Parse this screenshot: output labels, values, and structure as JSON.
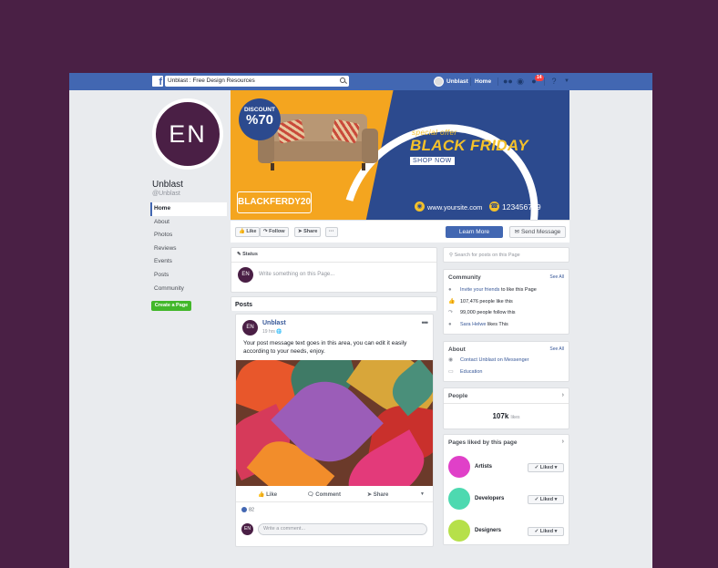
{
  "topbar": {
    "search_value": "Unblast : Free Design Resources",
    "user_name": "Unblast",
    "home_label": "Home",
    "notification_count": "14"
  },
  "profile": {
    "initials": "EN",
    "name": "Unblast",
    "handle": "@Unblast"
  },
  "nav": {
    "items": [
      "Home",
      "About",
      "Photos",
      "Reviews",
      "Events",
      "Posts",
      "Community"
    ],
    "create_page": "Create a Page"
  },
  "cover": {
    "discount_label": "DISCOUNT",
    "discount_value": "%70",
    "promo_code": "BLACKFERDY20",
    "special_offer": "special offer",
    "headline": "BLACK FRIDAY",
    "shop_now": "SHOP NOW",
    "website": "www.yoursite.com",
    "phone": "123456789",
    "colors": {
      "orange": "#f4a51f",
      "blue": "#2c4a8e",
      "yellow": "#f4c12a"
    }
  },
  "action_bar": {
    "like": "Like",
    "follow": "Follow",
    "share": "Share",
    "more": "···",
    "learn_more": "Learn More",
    "send_message": "Send Message"
  },
  "status": {
    "label": "Status",
    "avatar": "EN",
    "placeholder": "Write something on this Page..."
  },
  "posts": {
    "section_title": "Posts",
    "author": "Unblast",
    "time": "19 hrs",
    "text": "Your post message text goes in this area, you can edit it easily according to your needs, enjoy.",
    "actions": {
      "like": "Like",
      "comment": "Comment",
      "share": "Share"
    },
    "like_count": "82",
    "comment_placeholder": "Write a comment..."
  },
  "right": {
    "search_placeholder": "Search for posts on this Page",
    "community": {
      "title": "Community",
      "see_all": "See All",
      "invite": "Invite your friends",
      "invite_suffix": " to like this Page",
      "likes": "107,476 people like this",
      "follows": "99,000 people follow this",
      "friend": "Sara Helwe",
      "friend_suffix": " likes This"
    },
    "about": {
      "title": "About",
      "see_all": "See All",
      "contact": "Contact Unblast on Messenger",
      "category": "Education"
    },
    "people": {
      "title": "People",
      "count": "107k",
      "count_label": "likes"
    },
    "liked_pages": {
      "title": "Pages liked by this page",
      "button": "✓ Liked ▾",
      "items": [
        {
          "name": "Artists",
          "color": "#e040c8"
        },
        {
          "name": "Developers",
          "color": "#4dd9b0"
        },
        {
          "name": "Designers",
          "color": "#b6e04a"
        }
      ]
    }
  }
}
